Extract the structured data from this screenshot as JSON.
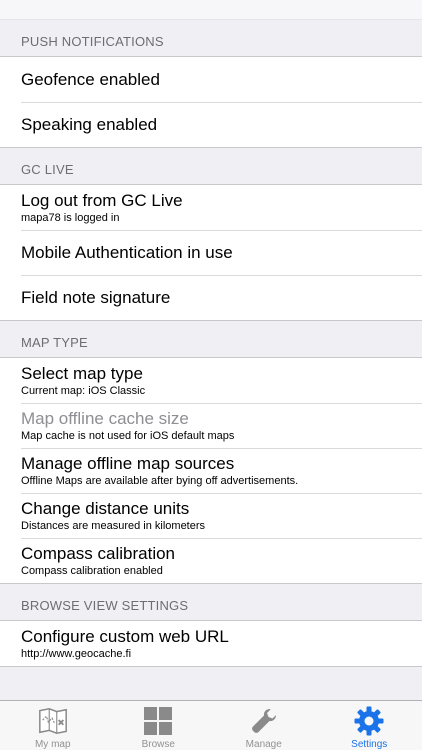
{
  "sections": [
    {
      "header": "PUSH NOTIFICATIONS",
      "rows": [
        {
          "title": "Geofence enabled",
          "subtitle": ""
        },
        {
          "title": "Speaking enabled",
          "subtitle": ""
        }
      ]
    },
    {
      "header": "GC LIVE",
      "rows": [
        {
          "title": "Log out from GC Live",
          "subtitle": "mapa78 is logged in"
        },
        {
          "title": "Mobile Authentication in use",
          "subtitle": ""
        },
        {
          "title": "Field note signature",
          "subtitle": ""
        }
      ]
    },
    {
      "header": "MAP TYPE",
      "rows": [
        {
          "title": "Select map type",
          "subtitle": "Current map: iOS Classic"
        },
        {
          "title": "Map offline cache size",
          "subtitle": "Map cache is not used for iOS default maps",
          "disabled": true
        },
        {
          "title": "Manage offline map sources",
          "subtitle": "Offline Maps are available after bying off advertisements."
        },
        {
          "title": "Change distance units",
          "subtitle": "Distances are measured in kilometers"
        },
        {
          "title": "Compass calibration",
          "subtitle": "Compass calibration enabled"
        }
      ]
    },
    {
      "header": "BROWSE VIEW SETTINGS",
      "rows": [
        {
          "title": "Configure custom web URL",
          "subtitle": "http://www.geocache.fi"
        }
      ]
    }
  ],
  "tabbar": {
    "tabs": [
      {
        "label": "My map",
        "icon": "map-icon"
      },
      {
        "label": "Browse",
        "icon": "grid-icon"
      },
      {
        "label": "Manage",
        "icon": "wrench-icon"
      },
      {
        "label": "Settings",
        "icon": "gear-icon",
        "active": true
      }
    ]
  },
  "colors": {
    "accent": "#1a73e8",
    "inactive": "#929292",
    "background": "#efeff4"
  }
}
